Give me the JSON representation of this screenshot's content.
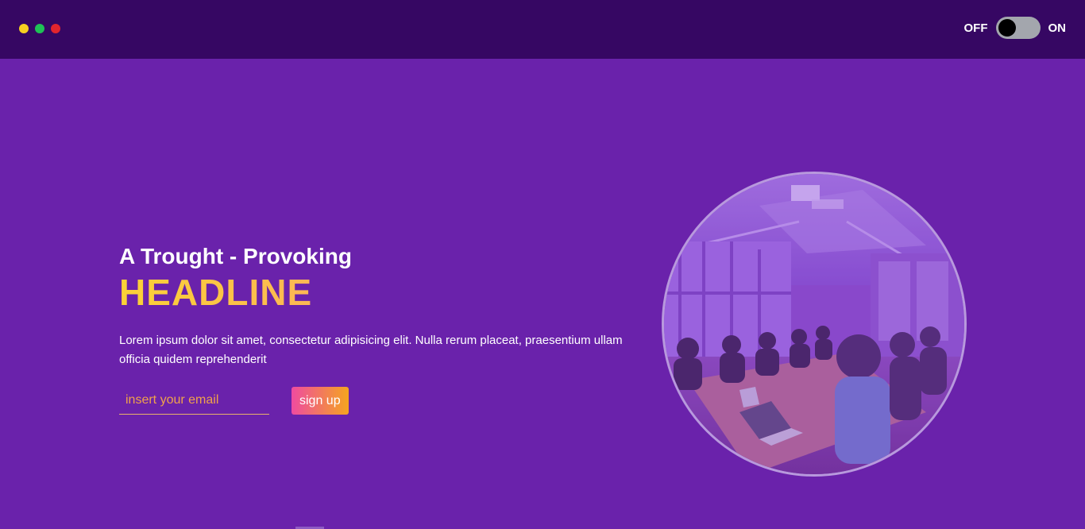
{
  "window": {
    "controls": [
      "yellow",
      "green",
      "red"
    ]
  },
  "toggle": {
    "off_label": "OFF",
    "on_label": "ON",
    "state": "off"
  },
  "hero": {
    "subhead": "A Trought - Provoking",
    "headline": "HEADLINE",
    "paragraph": "Lorem ipsum dolor sit amet, consectetur adipisicing elit. Nulla rerum placeat, praesentium ullam officia quidem reprehenderit",
    "email_placeholder": "insert your email",
    "signup_label": "sign up"
  },
  "colors": {
    "background": "#6a22ab",
    "topbar": "#360763",
    "headline_gradient": [
      "#fbd236",
      "#f9657f"
    ],
    "button_gradient": [
      "#ef4ba0",
      "#f5a51f"
    ]
  },
  "image": {
    "subject": "meeting-room-photo"
  }
}
